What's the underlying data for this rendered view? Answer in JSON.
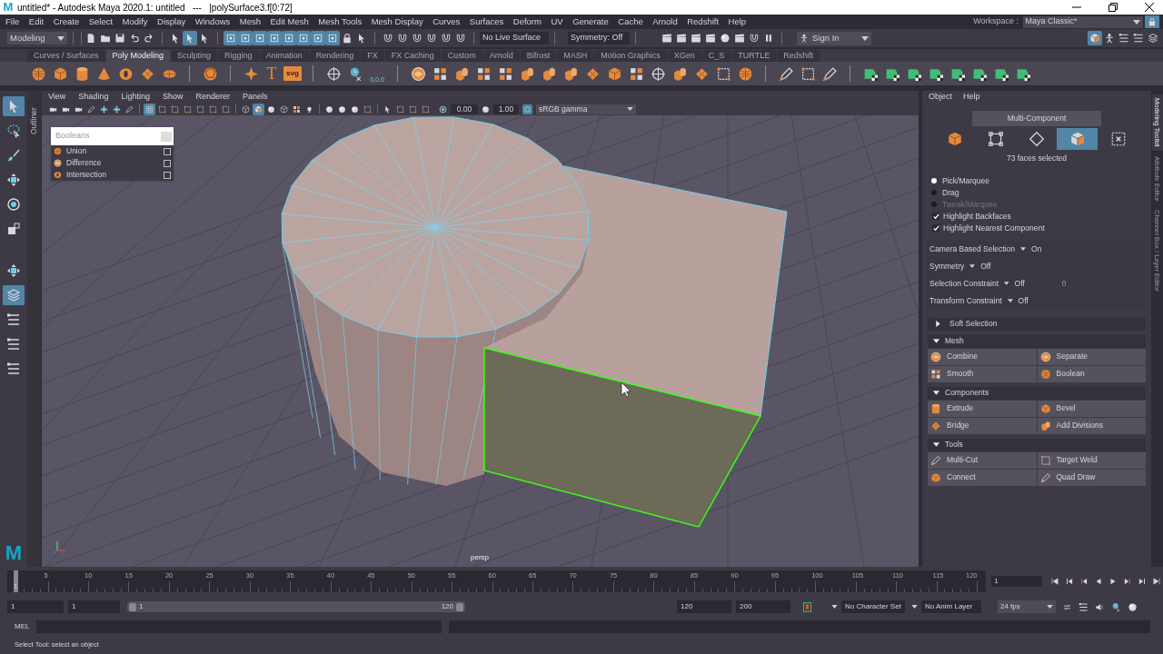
{
  "title_bar": {
    "logo": "M",
    "title": "untitled* - Autodesk Maya 2020.1: untitled   ---   |polySurface3.f[0:72]"
  },
  "menu_bar": {
    "items": [
      "File",
      "Edit",
      "Create",
      "Select",
      "Modify",
      "Display",
      "Windows",
      "Mesh",
      "Edit Mesh",
      "Mesh Tools",
      "Mesh Display",
      "Curves",
      "Surfaces",
      "Deform",
      "UV",
      "Generate",
      "Cache",
      "Arnold",
      "Redshift",
      "Help"
    ],
    "workspace_label": "Workspace :",
    "workspace": "Maya Classic*"
  },
  "status_line": {
    "mode": "Modeling",
    "groups": [
      [
        {
          "kind": "doc"
        },
        {
          "kind": "folder"
        },
        {
          "kind": "save"
        },
        {
          "kind": "undo"
        },
        {
          "kind": "redo"
        }
      ],
      [
        {
          "kind": "arrow",
          "selected": false
        },
        {
          "kind": "arrow",
          "selected": true
        },
        {
          "kind": "arrow",
          "selected": false
        }
      ],
      [
        {
          "kind": "mask",
          "selected": true
        },
        {
          "kind": "mask",
          "selected": true
        },
        {
          "kind": "mask",
          "selected": true
        },
        {
          "kind": "mask",
          "selected": true
        },
        {
          "kind": "mask",
          "selected": true
        },
        {
          "kind": "mask",
          "selected": true
        },
        {
          "kind": "mask",
          "selected": true
        },
        {
          "kind": "mask",
          "selected": true
        },
        {
          "kind": "lock",
          "selected": false
        },
        {
          "kind": "arrow",
          "selected": false
        }
      ],
      [
        {
          "kind": "magnet"
        },
        {
          "kind": "magnet"
        },
        {
          "kind": "magnet"
        },
        {
          "kind": "magnet"
        },
        {
          "kind": "magnet"
        },
        {
          "kind": "magnet"
        }
      ]
    ],
    "live_surface": "No Live Surface",
    "symmetry": "Symmetry: Off",
    "render_icons": [
      {
        "kind": "clapper"
      },
      {
        "kind": "clapper"
      },
      {
        "kind": "clapper"
      },
      {
        "kind": "clapper"
      },
      {
        "kind": "ball"
      },
      {
        "kind": "clapper"
      },
      {
        "kind": "magnet"
      },
      {
        "kind": "pause"
      }
    ],
    "sign_in": "Sign In",
    "right_icons": [
      {
        "kind": "shade",
        "selected": true
      },
      {
        "kind": "person",
        "selected": false
      },
      {
        "kind": "list",
        "selected": false
      },
      {
        "kind": "list",
        "selected": false
      },
      {
        "kind": "layers",
        "selected": false
      }
    ]
  },
  "shelf": {
    "tabs": [
      {
        "label": "Curves / Surfaces",
        "selected": false
      },
      {
        "label": "Poly Modeling",
        "selected": true
      },
      {
        "label": "Sculpting",
        "selected": false
      },
      {
        "label": "Rigging",
        "selected": false
      },
      {
        "label": "Animation",
        "selected": false
      },
      {
        "label": "Rendering",
        "selected": false
      },
      {
        "label": "FX",
        "selected": false
      },
      {
        "label": "FX Caching",
        "selected": false
      },
      {
        "label": "Custom",
        "selected": false
      },
      {
        "label": "Arnold",
        "selected": false
      },
      {
        "label": "Bifrost",
        "selected": false
      },
      {
        "label": "MASH",
        "selected": false
      },
      {
        "label": "Motion Graphics",
        "selected": false
      },
      {
        "label": "XGen",
        "selected": false
      },
      {
        "label": "C_S",
        "selected": false
      },
      {
        "label": "TURTLE",
        "selected": false
      },
      {
        "label": "Redshift",
        "selected": false
      }
    ],
    "groups": [
      [
        {
          "kind": "sphere"
        },
        {
          "kind": "cube"
        },
        {
          "kind": "cylinder"
        },
        {
          "kind": "cone"
        },
        {
          "kind": "torus"
        },
        {
          "kind": "diamond"
        },
        {
          "kind": "disc"
        }
      ],
      [
        {
          "kind": "platonic"
        }
      ],
      [
        {
          "kind": "star"
        },
        {
          "kind": "text",
          "label": "T"
        },
        {
          "kind": "badge",
          "label": "svg"
        }
      ],
      [
        {
          "kind": "target"
        },
        {
          "kind": "clock"
        },
        {
          "kind": "locator",
          "label": "0,0,0"
        }
      ],
      [
        {
          "kind": "combine"
        },
        {
          "kind": "tiles"
        },
        {
          "kind": "blocks"
        },
        {
          "kind": "tiles"
        },
        {
          "kind": "tiles"
        },
        {
          "kind": "blocks"
        },
        {
          "kind": "blocks"
        },
        {
          "kind": "blocks"
        },
        {
          "kind": "diamond"
        },
        {
          "kind": "cube"
        },
        {
          "kind": "tiles"
        },
        {
          "kind": "target"
        },
        {
          "kind": "blocks"
        },
        {
          "kind": "diamond"
        },
        {
          "kind": "frame"
        },
        {
          "kind": "sphere"
        }
      ],
      [
        {
          "kind": "pen"
        },
        {
          "kind": "frame"
        },
        {
          "kind": "pen"
        }
      ],
      [
        {
          "kind": "green"
        },
        {
          "kind": "green"
        },
        {
          "kind": "green"
        },
        {
          "kind": "green"
        },
        {
          "kind": "green"
        },
        {
          "kind": "green"
        },
        {
          "kind": "green"
        },
        {
          "kind": "green"
        }
      ]
    ]
  },
  "toolbox": [
    {
      "kind": "arrow",
      "selected": true
    },
    {
      "kind": "lasso",
      "selected": false
    },
    {
      "kind": "brush",
      "selected": false
    },
    {
      "kind": "move",
      "selected": false
    },
    {
      "kind": "rotate",
      "selected": false
    },
    {
      "kind": "scale",
      "selected": false
    },
    {
      "kind": "move",
      "selected": false
    },
    {
      "kind": "layers",
      "selected": true
    },
    {
      "kind": "list",
      "selected": false
    },
    {
      "kind": "list",
      "selected": false
    },
    {
      "kind": "list",
      "selected": false
    }
  ],
  "outliner_tab": "Outliner",
  "viewport": {
    "menu": [
      "View",
      "Shading",
      "Lighting",
      "Show",
      "Renderer",
      "Panels"
    ],
    "toolbar": [
      {
        "kind": "camera",
        "selected": false
      },
      {
        "kind": "camera",
        "selected": false
      },
      {
        "kind": "camera",
        "selected": false
      },
      {
        "kind": "pen",
        "selected": false
      },
      {
        "kind": "move",
        "selected": false
      },
      {
        "kind": "move",
        "selected": false
      },
      {
        "kind": "pen",
        "selected": false
      },
      {
        "kind": "grid",
        "selected": true
      },
      {
        "kind": "frame",
        "selected": false
      },
      {
        "kind": "frame",
        "selected": false
      },
      {
        "kind": "frame",
        "selected": false
      },
      {
        "kind": "frame",
        "selected": false
      },
      {
        "kind": "frame",
        "selected": false
      },
      {
        "kind": "frame",
        "selected": false
      },
      {
        "kind": "wire",
        "selected": false
      },
      {
        "kind": "shade",
        "selected": true
      },
      {
        "kind": "ball",
        "selected": false
      },
      {
        "kind": "wire",
        "selected": false
      },
      {
        "kind": "tiles",
        "selected": false
      },
      {
        "kind": "bulb",
        "selected": false
      },
      {
        "kind": "ball",
        "selected": false
      },
      {
        "kind": "ball",
        "selected": false
      },
      {
        "kind": "ball",
        "selected": false
      },
      {
        "kind": "frame",
        "selected": false
      },
      {
        "kind": "arrow",
        "selected": false
      },
      {
        "kind": "frame",
        "selected": false
      },
      {
        "kind": "frame",
        "selected": false
      },
      {
        "kind": "frame",
        "selected": false
      }
    ],
    "exposure": "0.00",
    "gamma": "1.00",
    "color_space": "sRGB gamma",
    "camera": "persp",
    "logo": "M",
    "booleans": {
      "title": "Booleans",
      "items": [
        {
          "label": "Union",
          "checked": false
        },
        {
          "label": "Difference",
          "checked": false
        },
        {
          "label": "Intersection",
          "checked": false
        }
      ]
    }
  },
  "modeling_toolkit": {
    "menu": [
      "Object",
      "Help"
    ],
    "mode_button": "Multi-Component",
    "component_modes": [
      {
        "kind": "object",
        "selected": false
      },
      {
        "kind": "vertex",
        "selected": false
      },
      {
        "kind": "edge",
        "selected": false
      },
      {
        "kind": "face",
        "selected": true
      },
      {
        "kind": "uv",
        "selected": false
      }
    ],
    "selection_info": "73 faces selected",
    "pick_modes": [
      {
        "label": "Pick/Marquee",
        "selected": true,
        "disabled": false
      },
      {
        "label": "Drag",
        "selected": false,
        "disabled": false
      },
      {
        "label": "Tweak/Marquee",
        "selected": false,
        "disabled": true
      }
    ],
    "options": [
      {
        "label": "Highlight Backfaces",
        "checked": true
      },
      {
        "label": "Highlight Nearest Component",
        "checked": true
      }
    ],
    "settings": [
      {
        "label": "Camera Based Selection",
        "value": "On"
      },
      {
        "label": "Symmetry",
        "value": "Off"
      },
      {
        "label": "Selection Constraint",
        "value": "Off",
        "field": "0"
      },
      {
        "label": "Transform Constraint",
        "value": "Off"
      }
    ],
    "sections": [
      {
        "title": "Soft Selection",
        "expanded": false
      },
      {
        "title": "Mesh",
        "expanded": true,
        "buttons": [
          {
            "label": "Combine",
            "kind": "combine"
          },
          {
            "label": "Separate",
            "kind": "combine"
          },
          {
            "label": "Smooth",
            "kind": "tiles"
          },
          {
            "label": "Boolean",
            "kind": "sphere"
          }
        ]
      },
      {
        "title": "Components",
        "expanded": true,
        "buttons": [
          {
            "label": "Extrude",
            "kind": "cylinder"
          },
          {
            "label": "Bevel",
            "kind": "cube"
          },
          {
            "label": "Bridge",
            "kind": "diamond"
          },
          {
            "label": "Add Divisions",
            "kind": "blocks"
          }
        ]
      },
      {
        "title": "Tools",
        "expanded": true,
        "buttons": [
          {
            "label": "Multi-Cut",
            "kind": "pen"
          },
          {
            "label": "Target Weld",
            "kind": "frame"
          },
          {
            "label": "Connect",
            "kind": "cube"
          },
          {
            "label": "Quad Draw",
            "kind": "pen"
          }
        ]
      }
    ]
  },
  "side_tabs": [
    {
      "label": "Modeling Toolkit",
      "selected": true
    },
    {
      "label": "Attribute Editor",
      "selected": false
    },
    {
      "label": "Channel Box / Layer Editor",
      "selected": false
    }
  ],
  "timeline": {
    "level": 0,
    "start": "1",
    "ticks": [
      "5",
      "10",
      "15",
      "20",
      "25",
      "30",
      "35",
      "40",
      "45",
      "50",
      "55",
      "60",
      "65",
      "70",
      "75",
      "80",
      "85",
      "90",
      "95",
      "100",
      "105",
      "110",
      "115",
      "120"
    ],
    "current_frame": "1",
    "playback": [
      {
        "kind": "first"
      },
      {
        "kind": "prevkey"
      },
      {
        "kind": "prev"
      },
      {
        "kind": "back"
      },
      {
        "kind": "play"
      },
      {
        "kind": "next"
      },
      {
        "kind": "nextkey"
      },
      {
        "kind": "last"
      }
    ]
  },
  "range": {
    "level": 1,
    "start": "1",
    "playback_start": "1",
    "slider_start": "1",
    "slider_end": "120",
    "playback_end": "120",
    "end": "200",
    "character_set": "No Character Set",
    "anim_layer": "No Anim Layer",
    "fps": "24 fps"
  },
  "command_line": {
    "language": "MEL"
  },
  "help_line": "Select Tool: select an object"
}
